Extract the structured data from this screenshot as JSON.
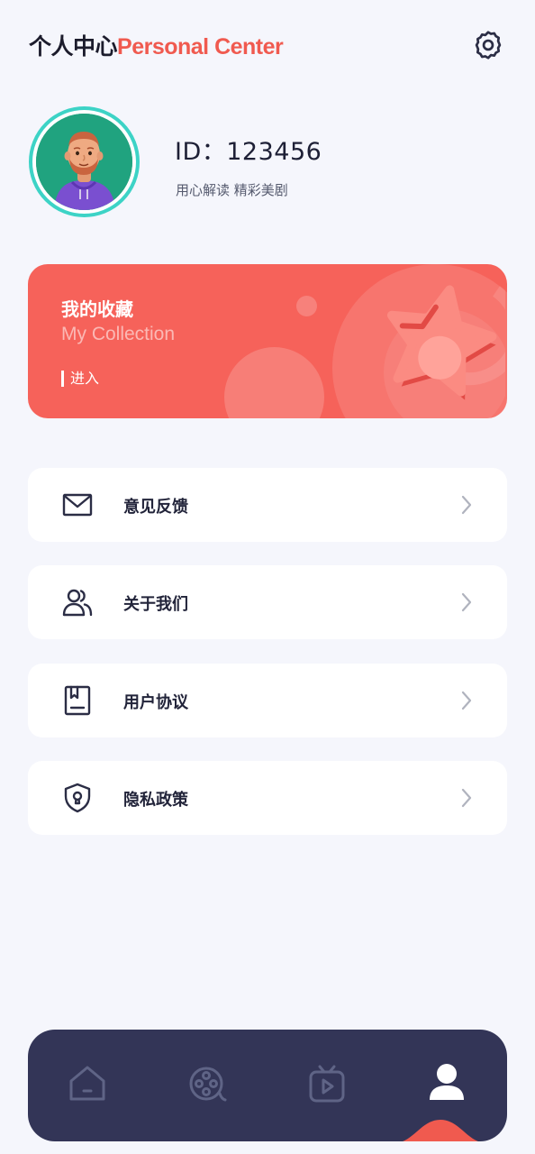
{
  "header": {
    "title_cn": "个人中心",
    "title_en": "Personal Center",
    "settings_icon": "gear-icon"
  },
  "profile": {
    "id_text": "ID：123456",
    "slogan": "用心解读 精彩美剧",
    "avatar": "cartoon-avatar"
  },
  "collection": {
    "title": "我的收藏",
    "subtitle": "My Collection",
    "enter": "进入",
    "color": "#f6625a",
    "icon": "star-icon"
  },
  "menu": [
    {
      "label": "意见反馈",
      "icon": "mail-icon"
    },
    {
      "label": "关于我们",
      "icon": "users-icon"
    },
    {
      "label": "用户协议",
      "icon": "document-icon"
    },
    {
      "label": "隐私政策",
      "icon": "shield-lock-icon"
    }
  ],
  "tabbar": {
    "tabs": [
      {
        "name": "home",
        "icon": "home-icon",
        "active": false
      },
      {
        "name": "film",
        "icon": "film-reel-icon",
        "active": false
      },
      {
        "name": "tv",
        "icon": "tv-play-icon",
        "active": false
      },
      {
        "name": "profile",
        "icon": "user-icon",
        "active": true
      }
    ],
    "background": "#333557",
    "accent": "#f05a4f"
  }
}
